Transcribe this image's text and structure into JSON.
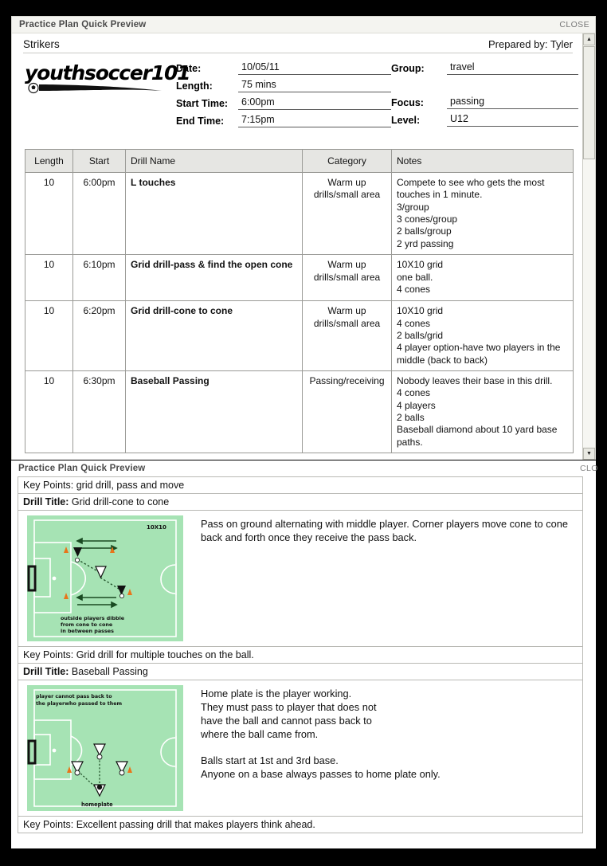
{
  "top_window": {
    "title": "Practice Plan Quick Preview",
    "close_label": "CLOSE",
    "team": "Strikers",
    "prepared_by": "Prepared by: Tyler",
    "logo_text": "youthsoccer101",
    "fields_left": [
      {
        "label": "Date:",
        "value": "10/05/11"
      },
      {
        "label": "Length:",
        "value": "75 mins"
      },
      {
        "label": "Start Time:",
        "value": "6:00pm"
      },
      {
        "label": "End Time:",
        "value": "7:15pm"
      }
    ],
    "fields_right": [
      {
        "label": "Group:",
        "value": "travel"
      },
      {
        "label": "Focus:",
        "value": "passing"
      },
      {
        "label": "Level:",
        "value": "U12"
      }
    ],
    "table": {
      "headers": [
        "Length",
        "Start",
        "Drill Name",
        "Category",
        "Notes"
      ],
      "rows": [
        {
          "length": "10",
          "start": "6:00pm",
          "drill_name": "L touches",
          "category": "Warm up drills/small area",
          "notes": "Compete to see who gets the most touches in 1 minute.\n3/group\n3 cones/group\n2 balls/group\n2 yrd passing"
        },
        {
          "length": "10",
          "start": "6:10pm",
          "drill_name": "Grid drill-pass & find the open cone",
          "category": "Warm up drills/small area",
          "notes": "10X10 grid\none ball.\n4 cones"
        },
        {
          "length": "10",
          "start": "6:20pm",
          "drill_name": "Grid drill-cone to cone",
          "category": "Warm up drills/small area",
          "notes": "10X10 grid\n4 cones\n2 balls/grid\n4 player option-have two players in the middle (back to back)"
        },
        {
          "length": "10",
          "start": "6:30pm",
          "drill_name": "Baseball Passing",
          "category": "Passing/receiving",
          "notes": "Nobody leaves their base in this drill.\n4 cones\n4 players\n2 balls\nBaseball diamond about 10 yard base paths."
        }
      ]
    }
  },
  "bottom_window": {
    "title": "Practice Plan Quick Preview",
    "close_label": "CLO",
    "key_points_top": "Key Points: grid drill, pass and move",
    "drills": [
      {
        "title_label": "Drill Title:",
        "title": "Grid drill-cone to cone",
        "description": "Pass on ground alternating with middle player. Corner players move cone to cone back and forth once they receive the pass back.",
        "diagram": {
          "grid_label": "10X10",
          "caption": "outside players dibble\nfrom cone to cone\nin between passes"
        },
        "key_points": "Key Points: Grid drill for multiple touches on the ball."
      },
      {
        "title_label": "Drill Title:",
        "title": "Baseball Passing",
        "description": "Home plate is the player working.\nThey must pass to player that does not\nhave the ball and cannot pass back to\nwhere the ball came from.\n\nBalls start at 1st and 3rd base.\nAnyone on a base always passes to home plate only.",
        "diagram": {
          "note": "player cannot pass back to\nthe playerwho passed to them",
          "home_label": "homeplate"
        },
        "key_points": "Key Points: Excellent passing drill that makes players think ahead."
      }
    ]
  },
  "colors": {
    "field_green": "#a6e3b4",
    "cone_orange": "#e8751a",
    "table_header_bg": "#e6e6e3",
    "window_border": "#9a9a96",
    "page_black": "#000000"
  }
}
